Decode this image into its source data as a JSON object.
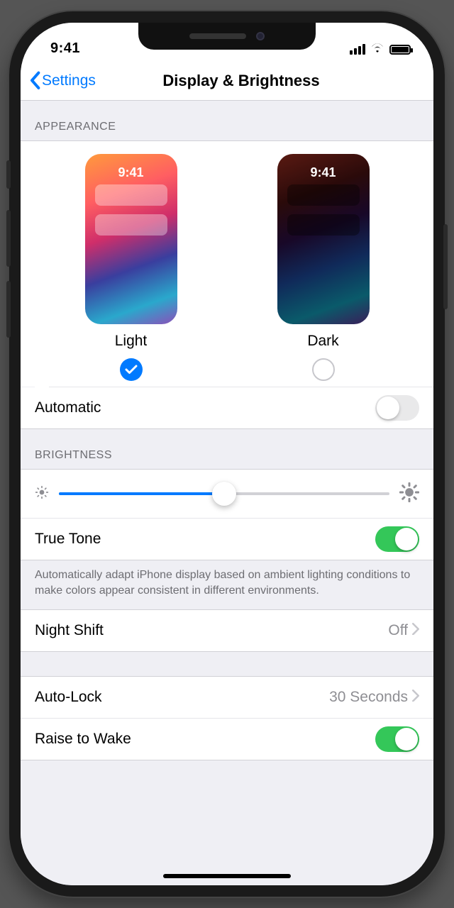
{
  "status": {
    "time": "9:41"
  },
  "nav": {
    "back": "Settings",
    "title": "Display & Brightness"
  },
  "sections": {
    "appearance": "APPEARANCE",
    "brightness": "BRIGHTNESS"
  },
  "appearance": {
    "light_label": "Light",
    "dark_label": "Dark",
    "preview_time": "9:41",
    "selected": "light",
    "automatic_label": "Automatic",
    "automatic_on": false
  },
  "brightness": {
    "value_percent": 50,
    "true_tone_label": "True Tone",
    "true_tone_on": true,
    "true_tone_footer": "Automatically adapt iPhone display based on ambient lighting conditions to make colors appear consistent in different environments."
  },
  "night_shift": {
    "label": "Night Shift",
    "value": "Off"
  },
  "auto_lock": {
    "label": "Auto-Lock",
    "value": "30 Seconds"
  },
  "raise_to_wake": {
    "label": "Raise to Wake",
    "on": true
  }
}
